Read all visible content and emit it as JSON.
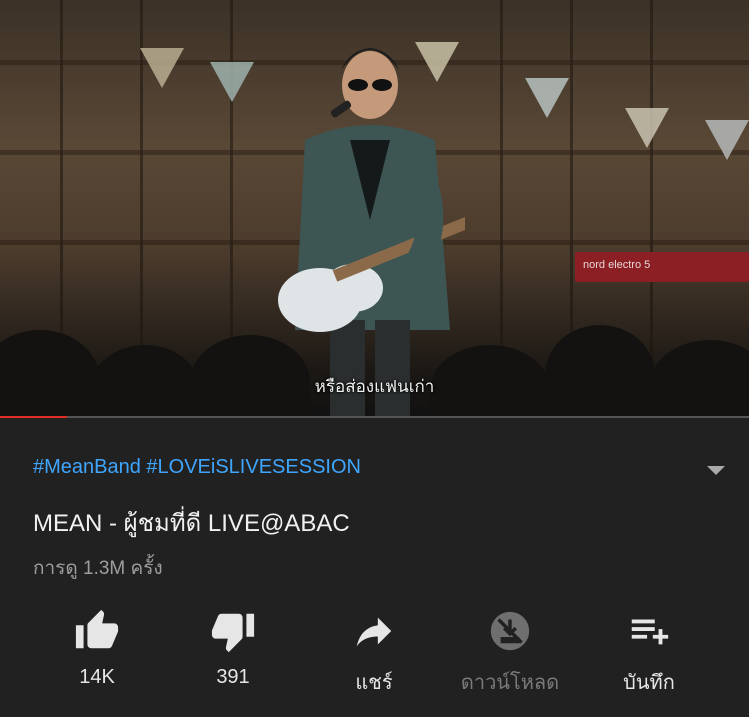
{
  "video": {
    "subtitle": "หรือส่องแฟนเก่า",
    "keyboard_brand": "nord electro 5",
    "progress": 0.09
  },
  "info": {
    "hashtags": "#MeanBand #LOVEiSLIVESESSION",
    "title": "MEAN - ผู้ชมที่ดี LIVE@ABAC",
    "views": "การดู 1.3M ครั้ง"
  },
  "actions": {
    "like": {
      "label": "14K",
      "icon": "thumbs-up-icon"
    },
    "dislike": {
      "label": "391",
      "icon": "thumbs-down-icon"
    },
    "share": {
      "label": "แชร์",
      "icon": "share-arrow-icon"
    },
    "download": {
      "label": "ดาวน์โหลด",
      "icon": "download-disabled-icon",
      "disabled": true
    },
    "save": {
      "label": "บันทึก",
      "icon": "playlist-add-icon"
    }
  },
  "colors": {
    "background": "#212121",
    "hashtag": "#3ea6ff",
    "progress": "#e52d27",
    "text": "#f1f1f1",
    "muted": "#9e9e9e"
  }
}
